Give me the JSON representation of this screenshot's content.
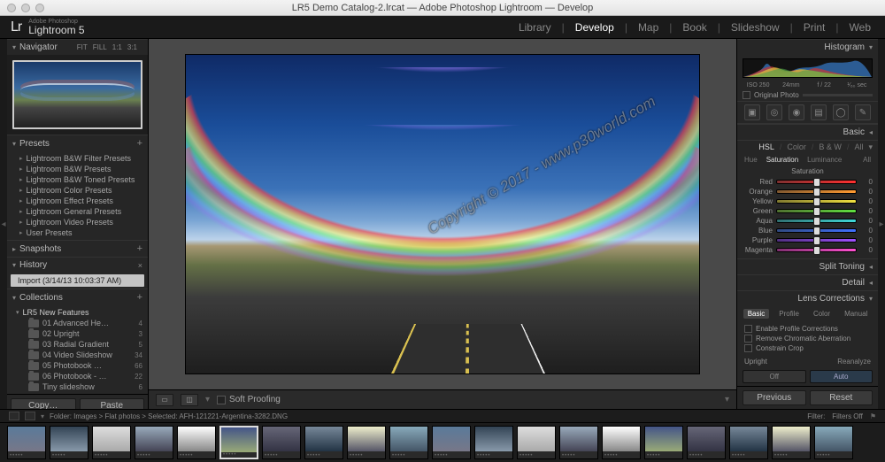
{
  "window": {
    "title": "LR5 Demo Catalog-2.lrcat — Adobe Photoshop Lightroom — Develop"
  },
  "brand": {
    "mark": "Lr",
    "super": "Adobe Photoshop",
    "name": "Lightroom 5"
  },
  "modules": {
    "items": [
      "Library",
      "Develop",
      "Map",
      "Book",
      "Slideshow",
      "Print",
      "Web"
    ],
    "active": "Develop"
  },
  "navigator": {
    "title": "Navigator",
    "opts": [
      "FIT",
      "FILL",
      "1:1",
      "3:1"
    ]
  },
  "presets": {
    "title": "Presets",
    "items": [
      "Lightroom B&W Filter Presets",
      "Lightroom B&W Presets",
      "Lightroom B&W Toned Presets",
      "Lightroom Color Presets",
      "Lightroom Effect Presets",
      "Lightroom General Presets",
      "Lightroom Video Presets",
      "User Presets"
    ]
  },
  "snapshots": {
    "title": "Snapshots"
  },
  "history": {
    "title": "History",
    "entry": "Import (3/14/13 10:03:37 AM)"
  },
  "collections": {
    "title": "Collections",
    "root": "LR5 New Features",
    "items": [
      {
        "name": "01 Advanced He…",
        "count": 4
      },
      {
        "name": "02 Upright",
        "count": 3
      },
      {
        "name": "03 Radial Gradient",
        "count": 5
      },
      {
        "name": "04 Video Slideshow",
        "count": 34
      },
      {
        "name": "05 Photobook …",
        "count": 66
      },
      {
        "name": "06 Photobook - …",
        "count": 22
      },
      {
        "name": "Tiny slideshow",
        "count": 6
      }
    ]
  },
  "leftbtns": {
    "copy": "Copy…",
    "paste": "Paste"
  },
  "toolbar": {
    "soft_proof": "Soft Proofing"
  },
  "histogram": {
    "title": "Histogram",
    "iso": "ISO 250",
    "focal": "24mm",
    "aperture": "f / 22",
    "shutter": "¹⁄₆₀ sec",
    "original": "Original Photo"
  },
  "basic": {
    "title": "Basic"
  },
  "hsl": {
    "tabs": [
      "HSL",
      "Color",
      "B & W",
      "All"
    ],
    "tabs_active": "HSL",
    "subtabs": [
      "Hue",
      "Saturation",
      "Luminance",
      "All"
    ],
    "subtabs_active": "Saturation",
    "group_title": "Saturation",
    "rows": [
      {
        "label": "Red",
        "from": "#803030",
        "to": "#ff3030",
        "pos": 50,
        "val": 0
      },
      {
        "label": "Orange",
        "from": "#805830",
        "to": "#ff9a30",
        "pos": 50,
        "val": 0
      },
      {
        "label": "Yellow",
        "from": "#807a30",
        "to": "#f0e040",
        "pos": 50,
        "val": 0
      },
      {
        "label": "Green",
        "from": "#507030",
        "to": "#60e040",
        "pos": 50,
        "val": 0
      },
      {
        "label": "Aqua",
        "from": "#307070",
        "to": "#40d8d8",
        "pos": 50,
        "val": 0
      },
      {
        "label": "Blue",
        "from": "#304a80",
        "to": "#4070ff",
        "pos": 50,
        "val": 0
      },
      {
        "label": "Purple",
        "from": "#503080",
        "to": "#a050ff",
        "pos": 50,
        "val": 0
      },
      {
        "label": "Magenta",
        "from": "#803070",
        "to": "#ff50d0",
        "pos": 50,
        "val": 0
      }
    ]
  },
  "panels_collapsed": {
    "split": "Split Toning",
    "detail": "Detail",
    "lens": "Lens Corrections"
  },
  "lens": {
    "tabs": [
      "Basic",
      "Profile",
      "Color",
      "Manual"
    ],
    "active": "Basic",
    "checks": [
      "Enable Profile Corrections",
      "Remove Chromatic Aberration",
      "Constrain Crop"
    ],
    "upright": "Upright",
    "reanalyze": "Reanalyze",
    "off": "Off",
    "auto": "Auto"
  },
  "rightbtns": {
    "prev": "Previous",
    "reset": "Reset"
  },
  "filmstrip": {
    "path": "Folder: Images > Flat photos > Selected: AFH-121221-Argentina-3282.DNG",
    "filter": "Filter:",
    "filters_off": "Filters Off",
    "count": 20,
    "selected_index": 5
  },
  "watermark": "Copyright © 2017 - www.p30world.com"
}
